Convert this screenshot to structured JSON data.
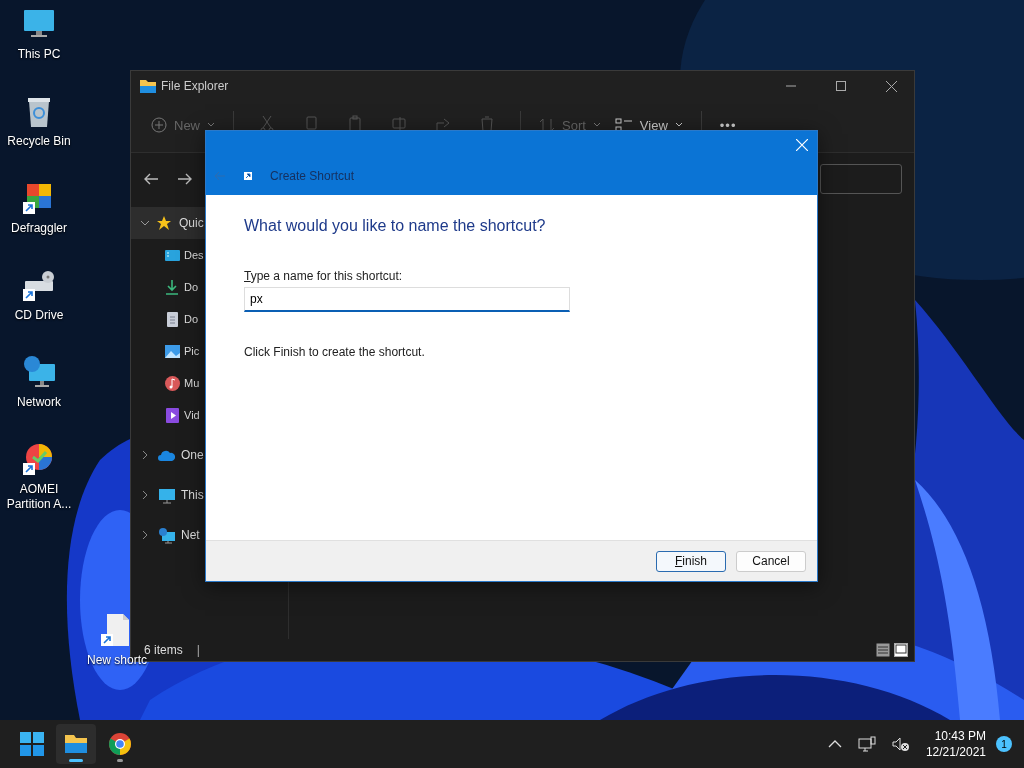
{
  "desktop": {
    "icons": [
      {
        "kind": "pc",
        "label": "This PC"
      },
      {
        "kind": "bin",
        "label": "Recycle Bin"
      },
      {
        "kind": "defrag",
        "label": "Defraggler"
      },
      {
        "kind": "cd",
        "label": "CD Drive"
      },
      {
        "kind": "network",
        "label": "Network"
      },
      {
        "kind": "aomei",
        "label": "AOMEI Partition A..."
      }
    ],
    "new_file": {
      "label": "New shortc"
    }
  },
  "explorer": {
    "title": "File Explorer",
    "toolbar": {
      "new_label": "New",
      "sort_label": "Sort",
      "view_label": "View",
      "more": "•••"
    },
    "sidebar": [
      {
        "kind": "star",
        "label": "Quic",
        "expanded": true,
        "selected": true,
        "children": [
          {
            "kind": "desktop",
            "label": "Des"
          },
          {
            "kind": "download",
            "label": "Do"
          },
          {
            "kind": "document",
            "label": "Do"
          },
          {
            "kind": "pictures",
            "label": "Pic"
          },
          {
            "kind": "music",
            "label": "Mu"
          },
          {
            "kind": "videos",
            "label": "Vid"
          }
        ]
      },
      {
        "kind": "cloud",
        "label": "One",
        "expanded": false,
        "selected": false
      },
      {
        "kind": "pc",
        "label": "This",
        "expanded": false,
        "selected": false
      },
      {
        "kind": "network",
        "label": "Net",
        "expanded": false,
        "selected": false
      }
    ],
    "status_bar": {
      "count": "6 items",
      "separator": "|"
    }
  },
  "dialog": {
    "title": "Create Shortcut",
    "heading": "What would you like to name the shortcut?",
    "field_label": "Type a name for this shortcut:",
    "field_label_underlined_key": true,
    "field_value": "px",
    "hint": "Click Finish to create the shortcut.",
    "buttons": [
      {
        "label": "Finish",
        "default": true,
        "underlined_key": true
      },
      {
        "label": "Cancel",
        "default": false
      }
    ]
  },
  "taskbar": {
    "apps": [
      {
        "kind": "explorer",
        "active": true
      },
      {
        "kind": "chrome",
        "active": false
      }
    ],
    "time": "10:43 PM",
    "date": "12/21/2021",
    "notifications": "1"
  }
}
